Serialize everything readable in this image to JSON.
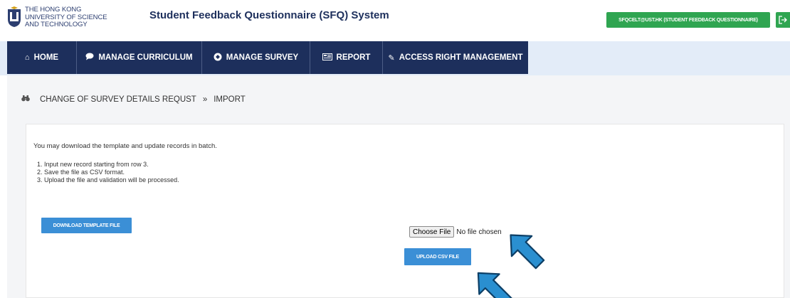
{
  "header": {
    "logo_lines": [
      "THE HONG KONG",
      "UNIVERSITY OF SCIENCE",
      "AND TECHNOLOGY"
    ],
    "app_title": "Student Feedback Questionnaire (SFQ) System",
    "user_badge": "SFQCELT@UST.HK (STUDENT FEEDBACK QUESTIONNAIRE)",
    "logout_icon": "logout-icon"
  },
  "nav": {
    "items": [
      {
        "label": "HOME",
        "icon": "home-icon"
      },
      {
        "label": "MANAGE CURRICULUM",
        "icon": "comment-icon"
      },
      {
        "label": "MANAGE SURVEY",
        "icon": "survey-icon"
      },
      {
        "label": "REPORT",
        "icon": "report-icon"
      },
      {
        "label": "ACCESS RIGHT MANAGEMENT",
        "icon": "pencil-icon"
      }
    ]
  },
  "breadcrumb": {
    "icon": "binoculars-icon",
    "items": [
      "CHANGE OF SURVEY DETAILS REQUST",
      "IMPORT"
    ],
    "separator": "»"
  },
  "main": {
    "intro": "You may download the template and update records in batch.",
    "steps": [
      "1. Input new record starting from row 3.",
      "2. Save the file as CSV format.",
      "3. Upload the file and validation will be processed."
    ],
    "download_button": "DOWNLOAD TEMPLATE FILE",
    "choose_file_button": "Choose File",
    "file_status": "No file chosen",
    "upload_button": "UPLOAD CSV FILE"
  },
  "colors": {
    "navy": "#1d2f5c",
    "green": "#2fa551",
    "blue_button": "#3b8fd6",
    "arrow": "#2a8fd0"
  }
}
